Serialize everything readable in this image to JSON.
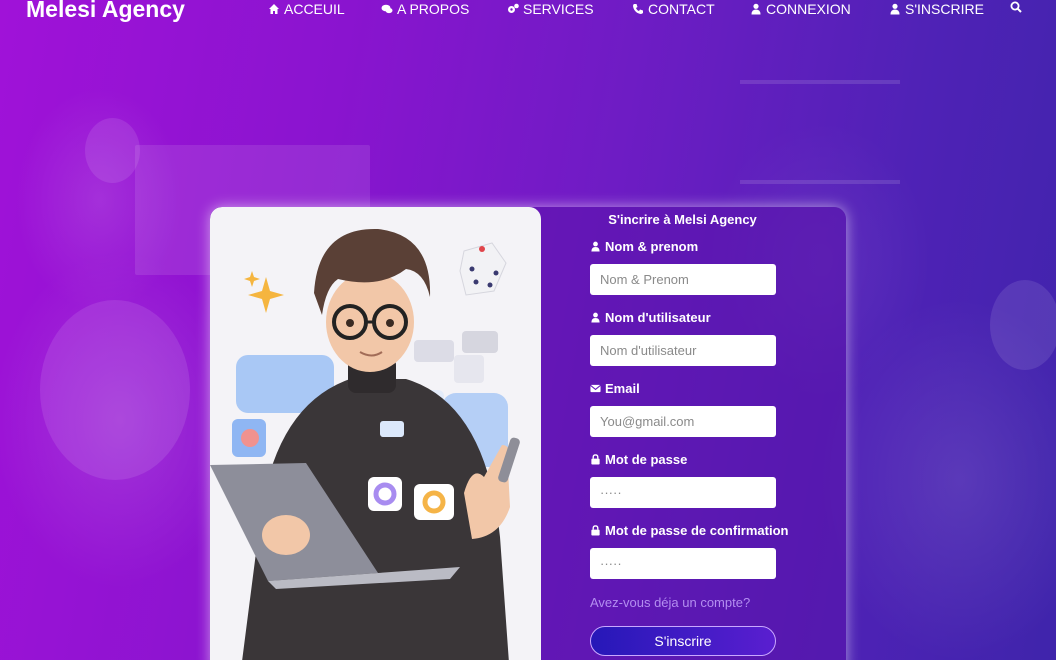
{
  "nav": {
    "brand": "Melesi Agency",
    "items": [
      {
        "label": "ACCEUIL",
        "icon": "home-icon"
      },
      {
        "label": "A PROPOS",
        "icon": "comments-icon"
      },
      {
        "label": "SERVICES",
        "icon": "cogs-icon"
      },
      {
        "label": "CONTACT",
        "icon": "phone-icon"
      },
      {
        "label": "CONNEXION",
        "icon": "user-icon"
      },
      {
        "label": "S'INSCRIRE",
        "icon": "user-icon"
      }
    ],
    "search_icon": "search-icon"
  },
  "form": {
    "title": "S'incrire à Melsi Agency",
    "fields": [
      {
        "label": "Nom & prenom",
        "icon": "user-icon",
        "placeholder": "Nom & Prenom",
        "type": "text"
      },
      {
        "label": "Nom d'utilisateur",
        "icon": "user-icon",
        "placeholder": "Nom d'utilisateur",
        "type": "text"
      },
      {
        "label": "Email",
        "icon": "envelope-icon",
        "placeholder": "You@gmail.com",
        "type": "email"
      },
      {
        "label": "Mot de passe",
        "icon": "lock-icon",
        "placeholder": "·····",
        "type": "password"
      },
      {
        "label": "Mot de passe de confirmation",
        "icon": "lock-icon",
        "placeholder": "·····",
        "type": "password"
      }
    ],
    "login_link": "Avez-vous déja un compte?",
    "submit_label": "S'inscrire"
  },
  "colors": {
    "accent": "#6a16c0",
    "button": "#2618b8",
    "link": "#b38ef0"
  }
}
